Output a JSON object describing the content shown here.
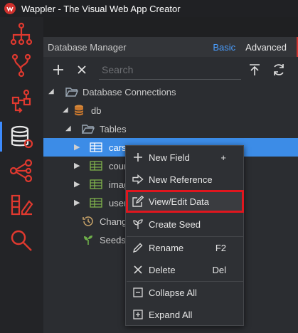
{
  "window": {
    "title": "Wappler - The Visual Web App Creator"
  },
  "panel": {
    "title": "Database Manager",
    "modes": {
      "basic": "Basic",
      "advanced": "Advanced"
    },
    "search": {
      "placeholder": "Search",
      "value": ""
    }
  },
  "tree": {
    "connections": "Database Connections",
    "db": "db",
    "tables": "Tables",
    "items": [
      "cars",
      "cour",
      "imag",
      "user"
    ],
    "changes": "Chang",
    "seeds": "Seeds"
  },
  "context_menu": {
    "new_field": {
      "label": "New Field",
      "shortcut": "+"
    },
    "new_reference": {
      "label": "New Reference"
    },
    "view_edit_data": {
      "label": "View/Edit Data"
    },
    "create_seed": {
      "label": "Create Seed"
    },
    "rename": {
      "label": "Rename",
      "shortcut": "F2"
    },
    "delete": {
      "label": "Delete",
      "shortcut": "Del"
    },
    "collapse_all": {
      "label": "Collapse All"
    },
    "expand_all": {
      "label": "Expand All"
    }
  },
  "colors": {
    "accent": "#3d8bfd",
    "selection": "#3c8ce7",
    "icon_red": "#d0312d",
    "highlight_outline": "#e0161e",
    "table_icon": "#7fb34c",
    "folder_icon": "#9aa7b4",
    "db_icon": "#d88a3c"
  },
  "icons": {
    "rail": [
      "app-flow-icon",
      "git-icon",
      "workflow-icon",
      "database-icon",
      "share-icon",
      "design-icon",
      "search-icon"
    ]
  }
}
